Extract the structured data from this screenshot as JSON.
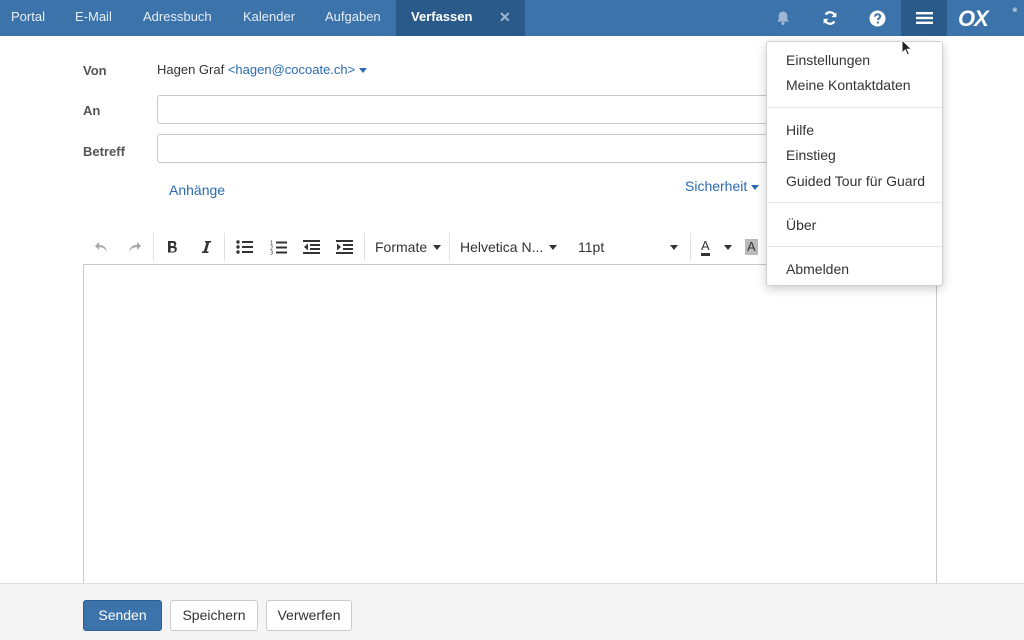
{
  "nav": {
    "tabs": [
      {
        "label": "Portal"
      },
      {
        "label": "E-Mail"
      },
      {
        "label": "Adressbuch"
      },
      {
        "label": "Kalender"
      },
      {
        "label": "Aufgaben"
      },
      {
        "label": "Verfassen",
        "active": true
      }
    ],
    "close_glyph": "✕",
    "icons": [
      "bell-icon",
      "refresh-icon",
      "help-icon",
      "menu-icon"
    ],
    "logo": "OX",
    "logo_mark": "®"
  },
  "compose": {
    "from_label": "Von",
    "from_name": "Hagen Graf",
    "from_email": "<hagen@cocoate.ch>",
    "to_label": "An",
    "to_value": "",
    "subject_label": "Betreff",
    "subject_value": "",
    "attachments_link": "Anhänge",
    "security_link": "Sicherheit"
  },
  "editor_toolbar": {
    "formats": "Formate",
    "font": "Helvetica N...",
    "size": "11pt",
    "text_color_glyph": "A",
    "bg_color_glyph": "A"
  },
  "footer": {
    "send": "Senden",
    "save": "Speichern",
    "discard": "Verwerfen"
  },
  "menu": {
    "items": [
      {
        "label": "Einstellungen"
      },
      {
        "label": "Meine Kontaktdaten"
      },
      {
        "label": "Hilfe"
      },
      {
        "label": "Einstieg"
      },
      {
        "label": "Guided Tour für Guard"
      },
      {
        "label": "Über"
      },
      {
        "label": "Abmelden"
      }
    ]
  },
  "colors": {
    "topbar": "#3c73aa",
    "topbar_active": "#2a5a8a",
    "link": "#2a6bb0",
    "primary_button": "#3c73aa"
  }
}
